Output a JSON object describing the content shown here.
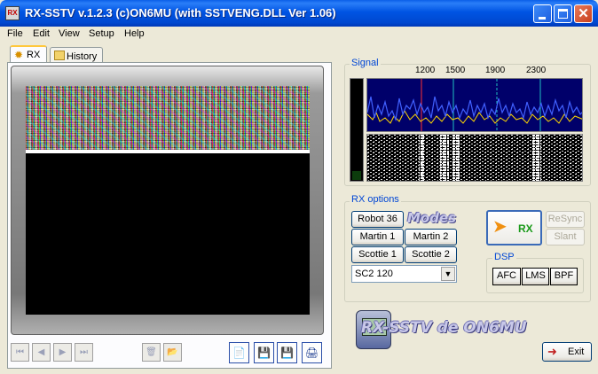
{
  "window": {
    "icon_text": "RX",
    "title": "RX-SSTV v.1.2.3 (c)ON6MU (with SSTVENG.DLL Ver 1.06)",
    "close_symbol": "✕"
  },
  "menu": [
    "File",
    "Edit",
    "View",
    "Setup",
    "Help"
  ],
  "tabs": {
    "rx": "RX",
    "history": "History"
  },
  "signal": {
    "label": "Signal",
    "frequencies": [
      "1200",
      "1500",
      "1900",
      "2300"
    ]
  },
  "rx_options": {
    "label": "RX options",
    "modes_logo": "Modes",
    "mode_buttons": [
      "Robot 36",
      "Martin 1",
      "Martin 2",
      "Scottie 1",
      "Scottie 2"
    ],
    "selected_mode": "SC2 120",
    "rx_button": "RX",
    "resync": "ReSync",
    "slant": "Slant"
  },
  "dsp": {
    "label": "DSP",
    "buttons": [
      "AFC",
      "LMS",
      "BPF"
    ]
  },
  "logo_text": "RX-SSTV de ON6MU",
  "exit_label": "Exit",
  "transport_icons": {
    "first": "⏮",
    "prev": "◀",
    "next": "▶",
    "last": "⏭",
    "delete": "🗑",
    "open": "📂",
    "copy": "📄",
    "save": "💾",
    "save_as": "💾",
    "print": "🖨"
  },
  "colors": {
    "title_bar": "#0054e3",
    "group_label": "#0046d5",
    "spectrum_bg": "#00006a",
    "spectrum_trace": "#4060ff",
    "spectrum_trace2": "#ffd800",
    "freq_marker_1200": "#ff3030",
    "freq_marker": "#20c0c0",
    "rx_text": "#1a9a1a"
  }
}
